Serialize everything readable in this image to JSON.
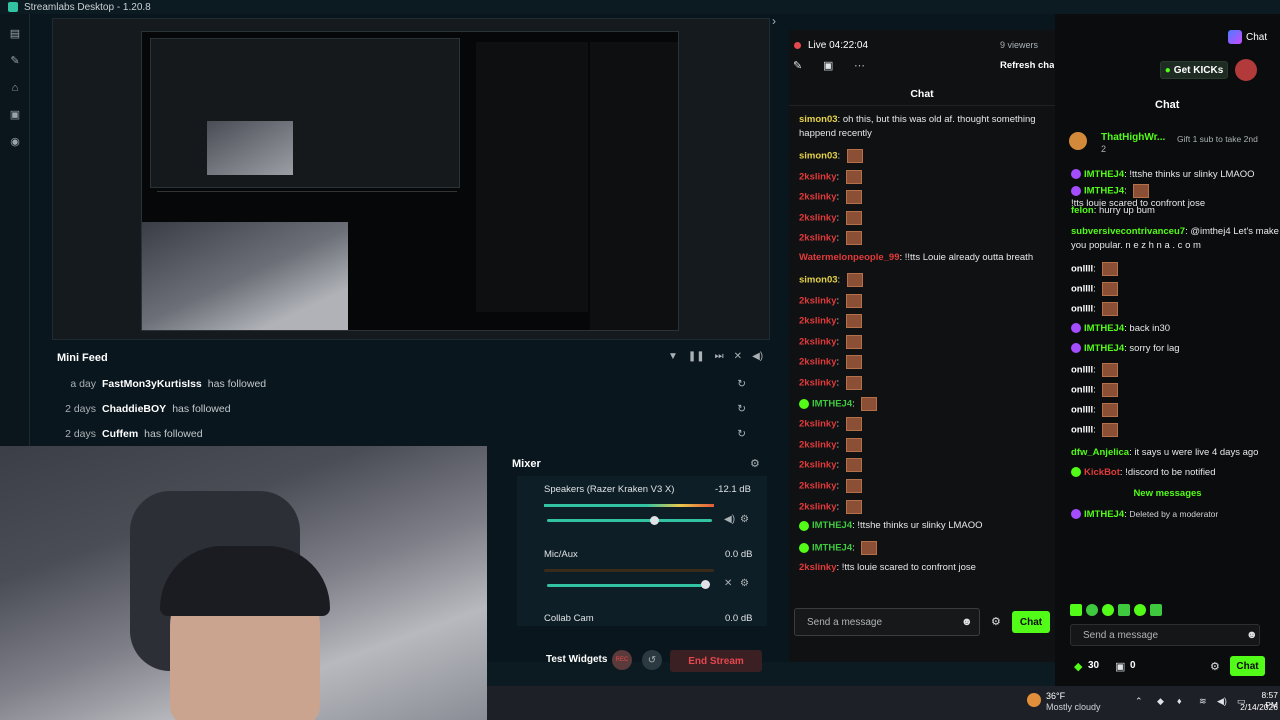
{
  "app": {
    "title": "Streamlabs Desktop - 1.20.8"
  },
  "colors": {
    "accent": "#31c3a2",
    "kick_green": "#53fc18",
    "end_stream": "#e5484d",
    "bg": "#09161d"
  },
  "left_nav": {
    "icons": [
      "editor-icon",
      "themes-icon",
      "store-icon",
      "studio-icon",
      "record-icon"
    ]
  },
  "mini_feed": {
    "title": "Mini Feed",
    "items": [
      {
        "age": "a day",
        "user": "FastMon3yKurtisIss",
        "action": "has followed"
      },
      {
        "age": "2 days",
        "user": "ChaddieBOY",
        "action": "has followed"
      },
      {
        "age": "2 days",
        "user": "Cuffem",
        "action": "has followed"
      }
    ]
  },
  "mixer": {
    "title": "Mixer",
    "channels": [
      {
        "name": "Speakers (Razer Kraken V3 X)",
        "db": "-12.1 dB",
        "level": 0.75
      },
      {
        "name": "Mic/Aux",
        "db": "0.0 dB",
        "level": 1.0
      },
      {
        "name": "Collab Cam",
        "db": "0.0 dB"
      }
    ]
  },
  "footer": {
    "test_widgets": "Test Widgets",
    "rec": "REC",
    "end_stream": "End Stream"
  },
  "stream_chat": {
    "live_time": "Live 04:22:04",
    "viewers": "9 viewers",
    "refresh": "Refresh chat",
    "title": "Chat",
    "input_placeholder": "Send a message",
    "send_button": "Chat",
    "messages": [
      {
        "user": "simon03",
        "text": "oh this, but this was old af. thought something"
      },
      {
        "user": "",
        "text": "happend recently"
      },
      {
        "user": "simon03",
        "text": ""
      },
      {
        "user": "2kslinky",
        "text": ""
      },
      {
        "user": "2kslinky",
        "text": ""
      },
      {
        "user": "2kslinky",
        "text": ""
      },
      {
        "user": "2kslinky",
        "text": ""
      },
      {
        "user": "Watermelonpeople_99",
        "text": "!!tts Louie already outta breath"
      },
      {
        "user": "simon03",
        "text": ""
      },
      {
        "user": "2kslinky",
        "text": ""
      },
      {
        "user": "2kslinky",
        "text": ""
      },
      {
        "user": "2kslinky",
        "text": ""
      },
      {
        "user": "2kslinky",
        "text": ""
      },
      {
        "user": "2kslinky",
        "text": ""
      },
      {
        "user": "IMTHEJ4",
        "text": ""
      },
      {
        "user": "2kslinky",
        "text": ""
      },
      {
        "user": "2kslinky",
        "text": ""
      },
      {
        "user": "2kslinky",
        "text": ""
      },
      {
        "user": "2kslinky",
        "text": ""
      },
      {
        "user": "2kslinky",
        "text": ""
      },
      {
        "user": "IMTHEJ4",
        "text": "!ttshe thinks ur slinky LMAOO"
      },
      {
        "user": "IMTHEJ4",
        "text": ""
      },
      {
        "user": "2kslinky",
        "text": "!tts louie scared to confront jose"
      }
    ]
  },
  "kick": {
    "get_kicks": "Get KICKs",
    "title": "Chat",
    "gift_user": "ThatHighWr...",
    "gift_count": "2",
    "gift_text": "Gift 1 sub to take 2nd",
    "messages": [
      {
        "user": "IMTHEJ4",
        "text": "!ttshe thinks ur slinky LMAOO"
      },
      {
        "user": "IMTHEJ4",
        "text": ""
      },
      {
        "user": "",
        "text": "!tts louie scared to confront jose"
      },
      {
        "user": "felon",
        "text": "hurry up bum"
      },
      {
        "user": "subversivecontrivanceu7",
        "text": "@imthej4 Let's make"
      },
      {
        "user": "",
        "text": "you popular. n e z h n a . c o m"
      },
      {
        "user": "onllll",
        "text": ""
      },
      {
        "user": "onllll",
        "text": ""
      },
      {
        "user": "onllll",
        "text": ""
      },
      {
        "user": "IMTHEJ4",
        "text": "back in30"
      },
      {
        "user": "IMTHEJ4",
        "text": "sorry for lag"
      },
      {
        "user": "onllll",
        "text": ""
      },
      {
        "user": "onllll",
        "text": ""
      },
      {
        "user": "onllll",
        "text": ""
      },
      {
        "user": "onllll",
        "text": ""
      },
      {
        "user": "dfw_Anjelica",
        "text": "it says u were live 4 days ago"
      },
      {
        "user": "KickBot",
        "text": "!discord to be notified"
      },
      {
        "user": "",
        "text": "New messages"
      },
      {
        "user": "IMTHEJ4",
        "text": "Deleted by a moderator"
      }
    ],
    "input_placeholder": "Send a message",
    "points": "30",
    "gifts": "0",
    "send_button": "Chat",
    "browser_chat": "Chat"
  },
  "taskbar": {
    "weather_temp": "36°F",
    "weather_desc": "Mostly cloudy",
    "time": "8:57 PM",
    "date": "2/14/2026"
  }
}
